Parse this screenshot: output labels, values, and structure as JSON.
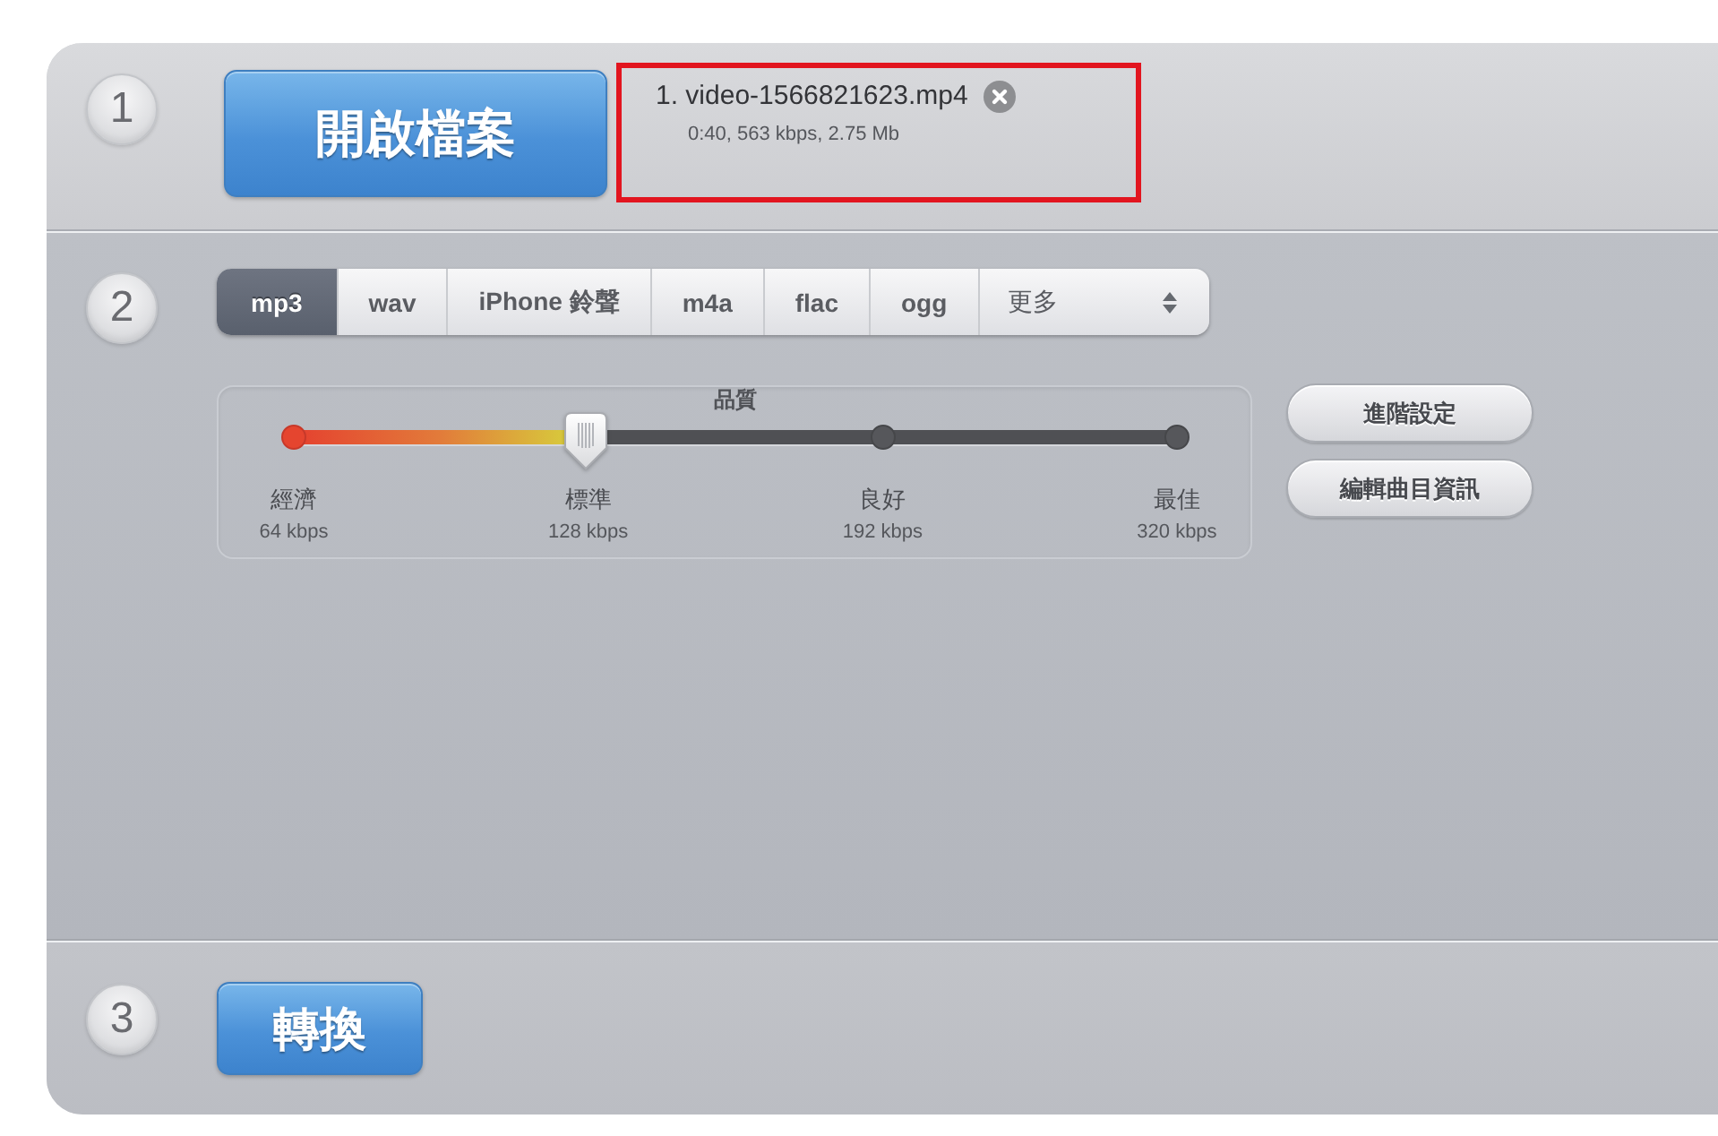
{
  "step_1": {
    "number": "1",
    "open_button": "開啟檔案",
    "files": [
      {
        "name": "1. video-1566821623.mp4",
        "details": "0:40, 563 kbps, 2.75 Mb",
        "highlighted": true
      }
    ]
  },
  "step_2": {
    "number": "2",
    "formats": [
      {
        "kind": "tab",
        "label": "mp3",
        "selected": true
      },
      {
        "kind": "tab",
        "label": "wav",
        "selected": false
      },
      {
        "kind": "tab",
        "label": "iPhone 鈴聲",
        "selected": false
      },
      {
        "kind": "tab",
        "label": "m4a",
        "selected": false
      },
      {
        "kind": "tab",
        "label": "flac",
        "selected": false
      },
      {
        "kind": "tab",
        "label": "ogg",
        "selected": false
      },
      {
        "kind": "dropdown",
        "label": "更多",
        "selected": false
      }
    ],
    "quality": {
      "title": "品質",
      "level": 0.33,
      "stops": [
        {
          "label": "經濟",
          "bitrate": "64 kbps"
        },
        {
          "label": "標準",
          "bitrate": "128 kbps"
        },
        {
          "label": "良好",
          "bitrate": "192 kbps"
        },
        {
          "label": "最佳",
          "bitrate": "320 kbps"
        }
      ]
    },
    "buttons": [
      "進階設定",
      "編輯曲目資訊"
    ]
  },
  "step_3": {
    "number": "3",
    "convert_button": "轉換"
  }
}
